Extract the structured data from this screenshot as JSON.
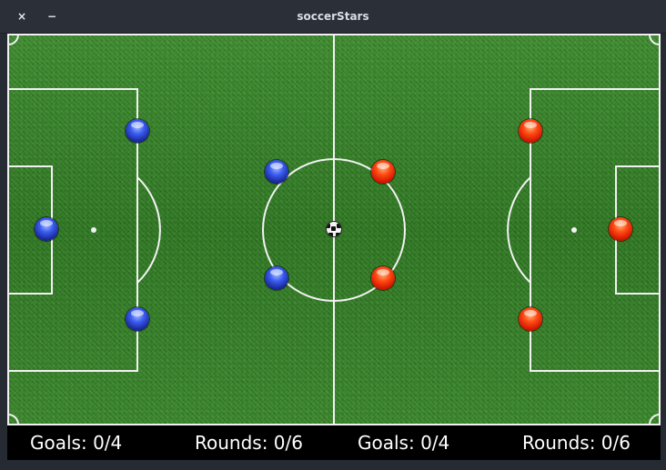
{
  "window": {
    "title": "soccerStars",
    "close_glyph": "×",
    "minimize_glyph": "−"
  },
  "team_left": {
    "color": "#2a3fd0",
    "goals_label": "Goals: 0/4",
    "rounds_label": "Rounds: 0/6"
  },
  "team_right": {
    "color": "#f03a0e",
    "goals_label": "Goals: 0/4",
    "rounds_label": "Rounds: 0/6"
  },
  "colors": {
    "pitch": "#3a8a2a",
    "lines": "#f2f2f2",
    "scorebar": "#000000",
    "titlebar": "#2b2f38"
  },
  "icons": {
    "close": "close-icon",
    "minimize": "minimize-icon",
    "ball": "soccer-ball-icon"
  }
}
